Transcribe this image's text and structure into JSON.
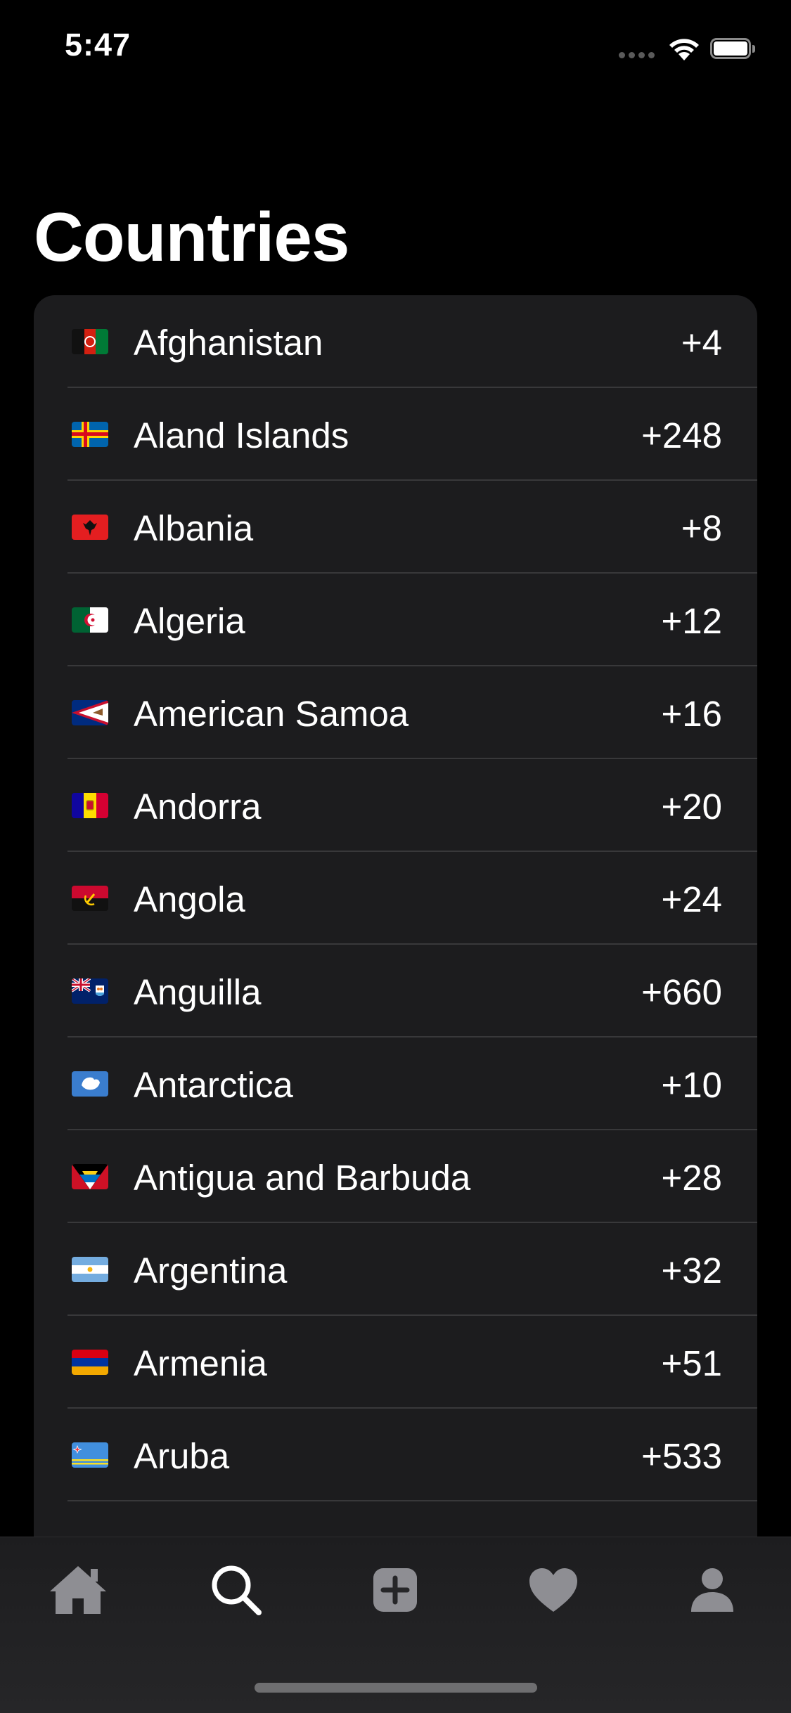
{
  "status_bar": {
    "time": "5:47"
  },
  "header": {
    "title": "Countries"
  },
  "countries": [
    {
      "name": "Afghanistan",
      "code": "+4",
      "flag": "afghanistan-flag"
    },
    {
      "name": "Aland Islands",
      "code": "+248",
      "flag": "aland-islands-flag"
    },
    {
      "name": "Albania",
      "code": "+8",
      "flag": "albania-flag"
    },
    {
      "name": "Algeria",
      "code": "+12",
      "flag": "algeria-flag"
    },
    {
      "name": "American Samoa",
      "code": "+16",
      "flag": "american-samoa-flag"
    },
    {
      "name": "Andorra",
      "code": "+20",
      "flag": "andorra-flag"
    },
    {
      "name": "Angola",
      "code": "+24",
      "flag": "angola-flag"
    },
    {
      "name": "Anguilla",
      "code": "+660",
      "flag": "anguilla-flag"
    },
    {
      "name": "Antarctica",
      "code": "+10",
      "flag": "antarctica-flag"
    },
    {
      "name": "Antigua and Barbuda",
      "code": "+28",
      "flag": "antigua-barbuda-flag"
    },
    {
      "name": "Argentina",
      "code": "+32",
      "flag": "argentina-flag"
    },
    {
      "name": "Armenia",
      "code": "+51",
      "flag": "armenia-flag"
    },
    {
      "name": "Aruba",
      "code": "+533",
      "flag": "aruba-flag"
    }
  ],
  "tab_bar": {
    "items": [
      {
        "icon": "home-icon",
        "active": false
      },
      {
        "icon": "search-icon",
        "active": true
      },
      {
        "icon": "add-icon",
        "active": false
      },
      {
        "icon": "heart-icon",
        "active": false
      },
      {
        "icon": "profile-icon",
        "active": false
      }
    ]
  },
  "colors": {
    "background": "#000000",
    "list_background": "#1c1c1e",
    "separator": "#38383a",
    "tab_icon_inactive": "#8e8e93",
    "tab_icon_active": "#ffffff"
  }
}
